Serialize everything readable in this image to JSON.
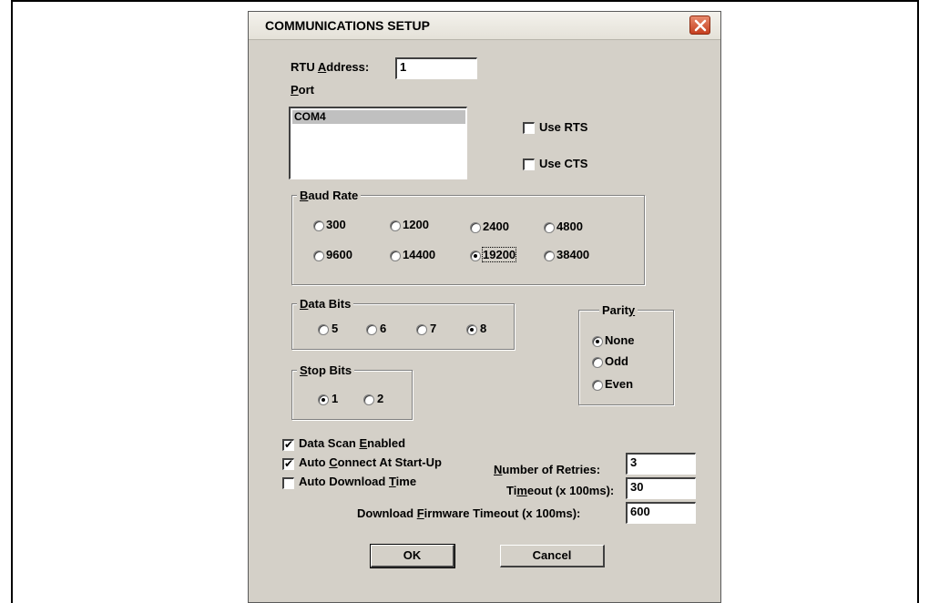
{
  "dialog": {
    "title": "COMMUNICATIONS SETUP",
    "close_icon": "close-icon"
  },
  "rtu": {
    "label_pre": "RTU ",
    "label_u": "A",
    "label_post": "ddress:",
    "value": "1"
  },
  "port": {
    "label_u": "P",
    "label_post": "ort",
    "items": [
      "COM4"
    ],
    "selected": "COM4"
  },
  "use_rts": {
    "label": "Use RTS",
    "checked": false
  },
  "use_cts": {
    "label": "Use CTS",
    "checked": false
  },
  "baud": {
    "label_u": "B",
    "label_post": "aud Rate",
    "options": [
      "300",
      "1200",
      "2400",
      "4800",
      "9600",
      "14400",
      "19200",
      "38400"
    ],
    "selected": "19200"
  },
  "data_bits": {
    "label_u": "D",
    "label_post": "ata Bits",
    "options": [
      "5",
      "6",
      "7",
      "8"
    ],
    "selected": "8"
  },
  "stop_bits": {
    "label_u": "S",
    "label_post": "top Bits",
    "options": [
      "1",
      "2"
    ],
    "selected": "1"
  },
  "parity": {
    "label_pre": "Parit",
    "label_u": "y",
    "options": [
      "None",
      "Odd",
      "Even"
    ],
    "selected": "None"
  },
  "checks": {
    "data_scan": {
      "pre": "Data Scan ",
      "u": "E",
      "post": "nabled",
      "checked": true
    },
    "auto_connect": {
      "pre": "Auto ",
      "u": "C",
      "post": "onnect At Start-Up",
      "checked": true
    },
    "auto_download": {
      "pre": "Auto Download ",
      "u": "T",
      "post": "ime",
      "checked": false
    }
  },
  "fields": {
    "retries": {
      "u": "N",
      "post": "umber of Retries:",
      "value": "3"
    },
    "timeout": {
      "pre": "Ti",
      "u": "m",
      "post": "eout (x 100ms):",
      "value": "30"
    },
    "fw_timeout": {
      "pre": "Download ",
      "u": "F",
      "post": "irmware Timeout (x 100ms):",
      "value": "600"
    }
  },
  "buttons": {
    "ok": "OK",
    "cancel": "Cancel"
  }
}
